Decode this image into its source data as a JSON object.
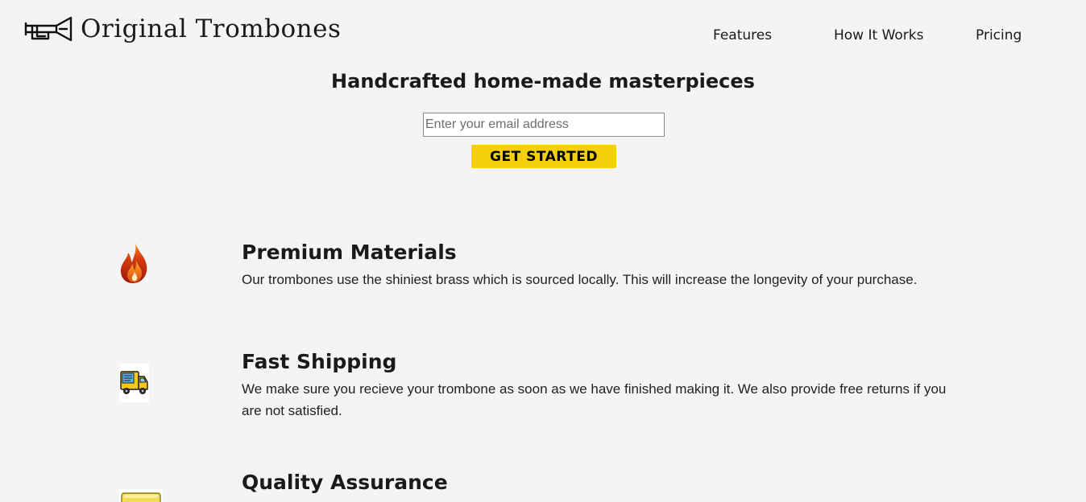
{
  "header": {
    "logo_text": "Original Trombones",
    "logo_icon": "trombone-icon",
    "nav": [
      {
        "label": "Features"
      },
      {
        "label": "How It Works"
      },
      {
        "label": "Pricing"
      }
    ]
  },
  "hero": {
    "title": "Handcrafted home-made masterpieces",
    "email_placeholder": "Enter your email address",
    "email_value": "",
    "cta_label": "GET STARTED"
  },
  "features": [
    {
      "icon": "flame-icon",
      "title": "Premium Materials",
      "description": "Our trombones use the shiniest brass which is sourced locally. This will increase the longevity of your purchase."
    },
    {
      "icon": "delivery-truck-icon",
      "title": "Fast Shipping",
      "description": "We make sure you recieve your trombone as soon as we have finished making it. We also provide free returns if you are not satisfied."
    },
    {
      "icon": "quality-badge-icon",
      "title": "Quality Assurance",
      "description": ""
    }
  ],
  "colors": {
    "background": "#f4f4f4",
    "cta_background": "#f5cf0b",
    "text": "#1a1a1a"
  }
}
